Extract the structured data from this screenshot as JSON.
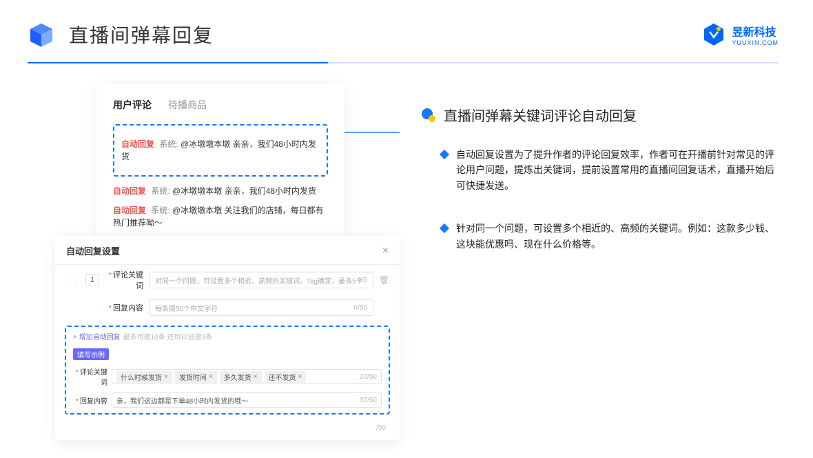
{
  "header": {
    "title": "直播间弹幕回复",
    "brand_cn": "昱新科技",
    "brand_en": "YUUXIN.COM"
  },
  "comments": {
    "tab_active": "用户评论",
    "tab_other": "待播商品",
    "auto_tag": "自动回复",
    "sys_label": "系统:",
    "row1": "@冰墩墩本墩 亲亲，我们48小时内发货",
    "row2": "@冰墩墩本墩 亲亲，我们48小时内发货",
    "row3": "@冰墩墩本墩 关注我们的店铺，每日都有热门推荐呦～"
  },
  "settings": {
    "title": "自动回复设置",
    "order": "1",
    "keyword_label": "评论关键词",
    "keyword_ph": "对同一个问题，可设置多个相近、高频的关键词。Tag确定，最多5个",
    "keyword_counter": "0/5",
    "content_label": "回复内容",
    "content_ph": "每条限50个中文字符",
    "content_counter": "0/50",
    "extra_counter": "/50"
  },
  "example": {
    "add": "+ 增加自动回复",
    "limit": "最多可建10条 还可以创建9条",
    "badge": "填写示例",
    "keyword_label": "评论关键词",
    "tags": [
      "什么时候发货",
      "发货时间",
      "多久发货",
      "还不发货"
    ],
    "key_counter": "20/50",
    "content_label": "回复内容",
    "content": "亲，我们这边都是下单48小时内发货的哦～",
    "content_counter": "37/50"
  },
  "right": {
    "title": "直播间弹幕关键词评论自动回复",
    "b1": "自动回复设置为了提升作者的评论回复效率，作者可在开播前针对常见的评论用户问题，提炼出关键词，提前设置常用的直播间回复话术，直播开始后可快捷发送。",
    "b2": "针对同一个问题，可设置多个相近的、高频的关键词。例如：这款多少钱、这块能优惠吗、现在什么价格等。"
  }
}
